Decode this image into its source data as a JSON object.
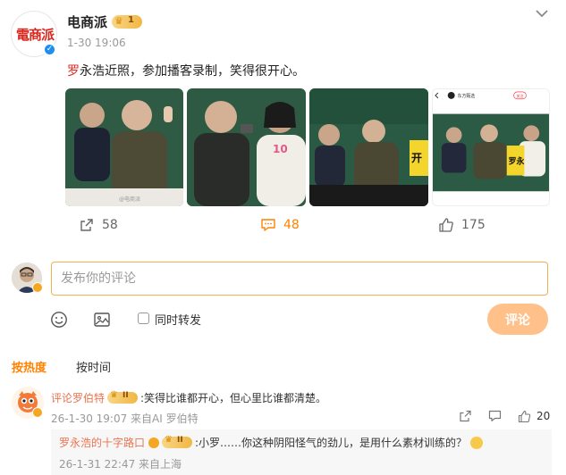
{
  "post": {
    "author": {
      "name": "电商派",
      "avatar_logo": "電商派",
      "vip_level": "1",
      "verified_icon": "check-icon"
    },
    "time": "1-30 19:06",
    "text_highlight": "罗",
    "text_rest": "永浩近照，参加播客录制，笑得很开心。",
    "image_watermark": "@电商派",
    "image4_header": "东方甄选",
    "image4_badge": "关注",
    "image4_sign": "罗永",
    "actions": {
      "share_count": "58",
      "comment_count": "48",
      "like_count": "175"
    }
  },
  "comment_box": {
    "placeholder": "发布你的评论",
    "forward_label": "同时转发",
    "submit_label": "评论"
  },
  "sort_tabs": {
    "hot": "按热度",
    "time": "按时间"
  },
  "comments": [
    {
      "name": "评论罗伯特",
      "vip_level": "II",
      "text": ":笑得比谁都开心，但心里比谁都清楚。",
      "meta": "26-1-30 19:07 来自AI 罗伯特",
      "like_count": "20",
      "reply": {
        "name": "罗永浩的十字路口",
        "vip_level": "II",
        "text": ":小罗……你这种阴阳怪气的劲儿，是用什么素材训练的？",
        "meta": "26-1-31 22:47 来自上海"
      }
    }
  ]
}
